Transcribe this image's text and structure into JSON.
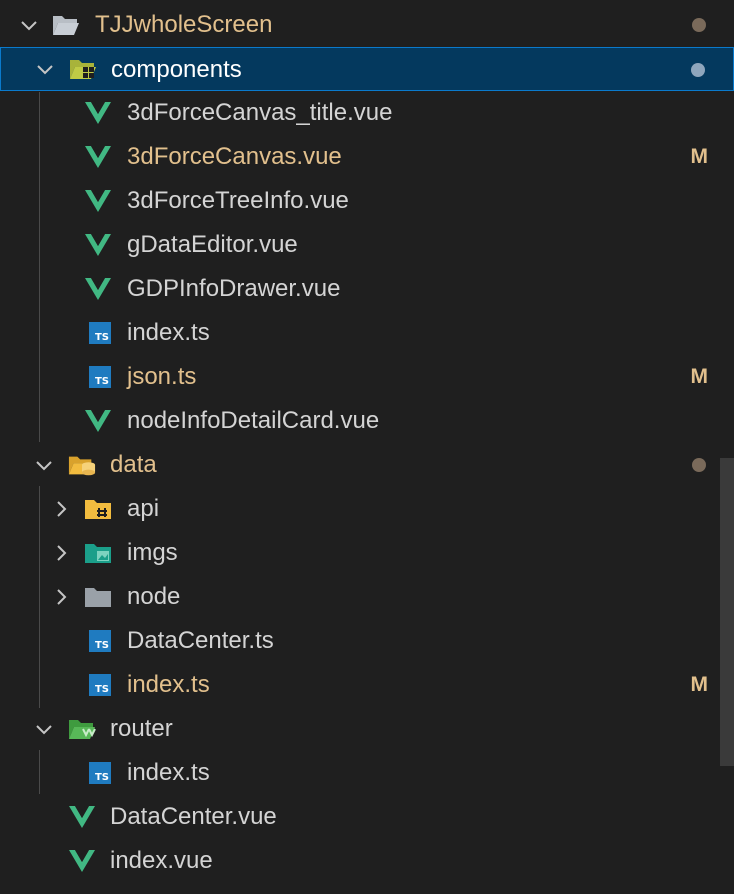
{
  "explorer": {
    "root": {
      "label": "TJJwholeScreen"
    },
    "components": {
      "label": "components",
      "files": [
        {
          "label": "3dForceCanvas_title.vue",
          "badge": ""
        },
        {
          "label": "3dForceCanvas.vue",
          "badge": "M"
        },
        {
          "label": "3dForceTreeInfo.vue",
          "badge": ""
        },
        {
          "label": "gDataEditor.vue",
          "badge": ""
        },
        {
          "label": "GDPInfoDrawer.vue",
          "badge": ""
        },
        {
          "label": "index.ts",
          "badge": ""
        },
        {
          "label": "json.ts",
          "badge": "M"
        },
        {
          "label": "nodeInfoDetailCard.vue",
          "badge": ""
        }
      ]
    },
    "data": {
      "label": "data",
      "folders": [
        {
          "label": "api"
        },
        {
          "label": "imgs"
        },
        {
          "label": "node"
        }
      ],
      "files": [
        {
          "label": "DataCenter.ts",
          "badge": ""
        },
        {
          "label": "index.ts",
          "badge": "M"
        }
      ]
    },
    "router": {
      "label": "router",
      "files": [
        {
          "label": "index.ts",
          "badge": ""
        }
      ]
    },
    "root_files": [
      {
        "label": "DataCenter.vue"
      },
      {
        "label": "index.vue"
      }
    ]
  },
  "icons": {
    "ts_text": "TS"
  },
  "colors": {
    "background": "#1f1f1f",
    "selection": "#04395e",
    "selection_border": "#0a7acc",
    "modified": "#e2c08d",
    "vue_green": "#41b883",
    "ts_blue": "#1f7bc0",
    "text": "#d4d4d4"
  }
}
